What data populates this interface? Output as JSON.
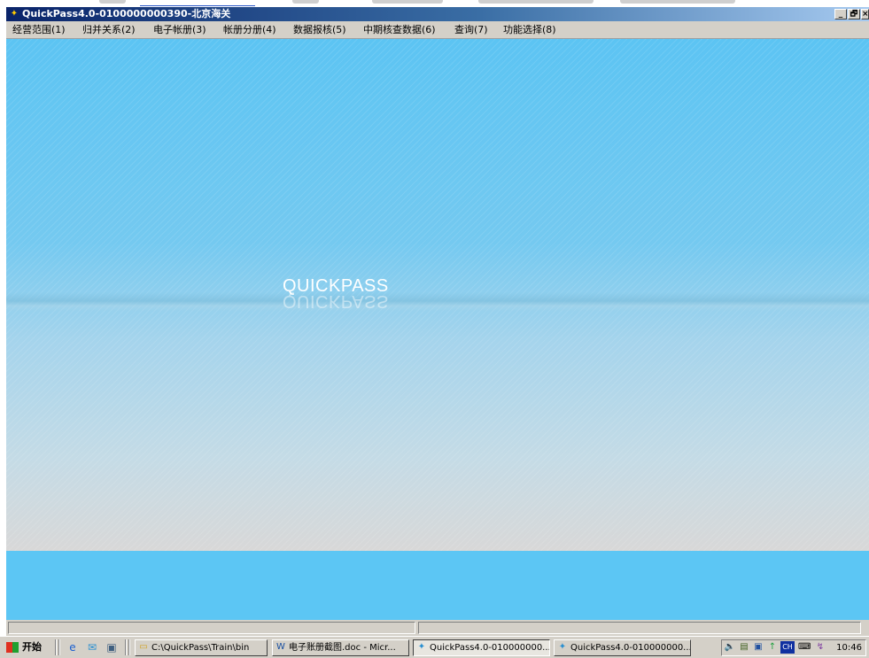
{
  "window": {
    "title": "QuickPass4.0-0100000000390-北京海关",
    "controls": {
      "minimize": "_",
      "maximize": "🗗",
      "close": "×"
    }
  },
  "menu": [
    "经营范围(1)",
    "归并关系(2)",
    "电子帐册(3)",
    "帐册分册(4)",
    "数据报核(5)",
    "中期核查数据(6)",
    "查询(7)",
    "功能选择(8)"
  ],
  "splash": {
    "logo_text": "QUICKPASS"
  },
  "taskbar": {
    "start_label": "开始",
    "quick_launch_icons": [
      "ie-icon",
      "outlook-icon",
      "desktop-icon"
    ],
    "tasks": [
      {
        "label": "C:\\QuickPass\\Train\\bin",
        "icon": "folder-icon",
        "active": false
      },
      {
        "label": "电子账册截图.doc - Micr...",
        "icon": "word-icon",
        "active": false
      },
      {
        "label": "QuickPass4.0-010000000...",
        "icon": "app-icon",
        "active": true
      },
      {
        "label": "QuickPass4.0-010000000...",
        "icon": "app-icon",
        "active": false
      }
    ],
    "tray": {
      "icons": [
        "volume-icon",
        "network-icon",
        "monitor-icon",
        "arrow-icon",
        "ime-ch-icon",
        "keyboard-icon",
        "tool-icon"
      ],
      "ime_label": "CH",
      "clock": "10:46"
    }
  },
  "colors": {
    "titlebar_start": "#0a246a",
    "sky_blue": "#5cc4f3",
    "chrome_gray": "#d4d0c8"
  }
}
